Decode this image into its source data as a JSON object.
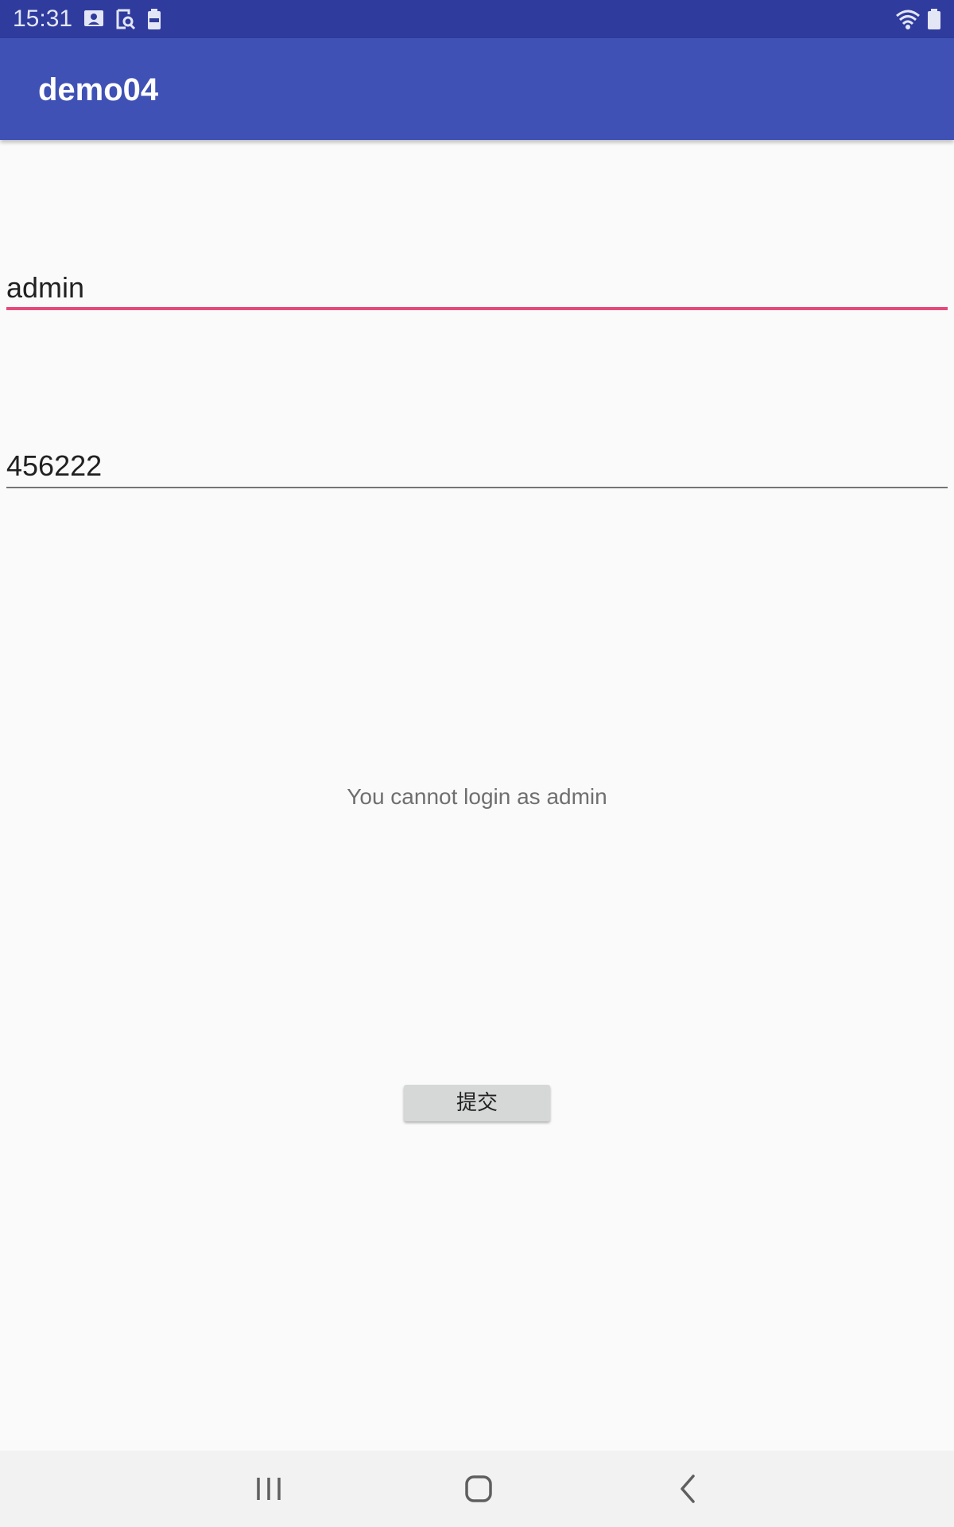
{
  "status_bar": {
    "time": "15:31",
    "icons": [
      "image-notification-icon",
      "screenshot-notification-icon",
      "battery-100-small-icon",
      "wifi-icon",
      "battery-icon"
    ]
  },
  "app_bar": {
    "title": "demo04"
  },
  "form": {
    "username_value": "admin",
    "password_value": "456222",
    "message": "You cannot login as admin",
    "submit_label": "提交"
  },
  "nav_bar": {
    "icons": [
      "recents-icon",
      "home-icon",
      "back-icon"
    ]
  },
  "colors": {
    "status_bar": "#2f3c9e",
    "app_bar": "#3f51b5",
    "accent": "#e64a7b",
    "background": "#fafafa",
    "nav_bar": "#f2f2f2"
  }
}
